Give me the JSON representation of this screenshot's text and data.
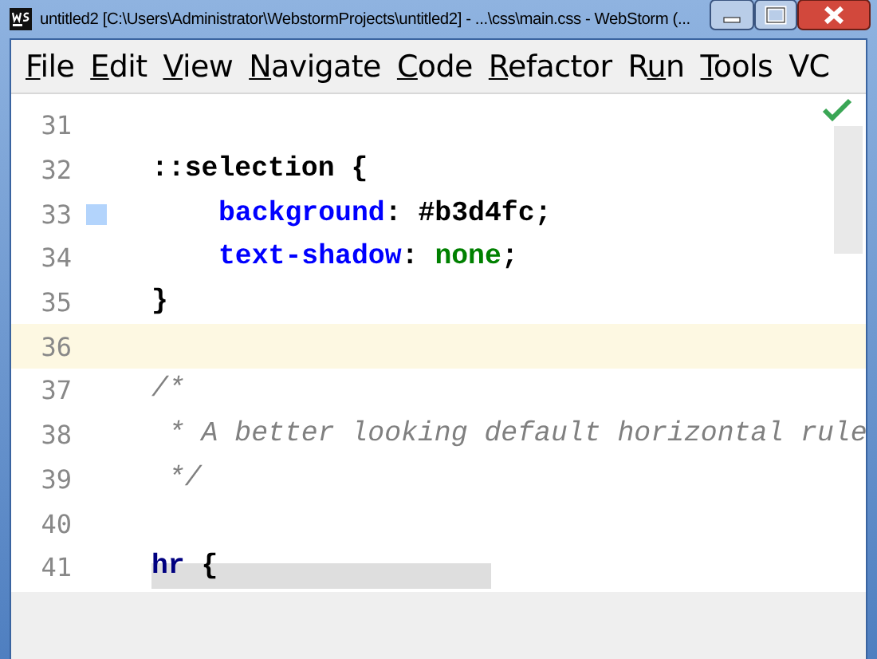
{
  "window": {
    "title": "untitled2 [C:\\Users\\Administrator\\WebstormProjects\\untitled2] - ...\\css\\main.css - WebStorm (..."
  },
  "menu": [
    {
      "parts": [
        {
          "text": "F",
          "underline": true
        },
        {
          "text": "ile",
          "underline": false
        }
      ]
    },
    {
      "parts": [
        {
          "text": "E",
          "underline": true
        },
        {
          "text": "dit",
          "underline": false
        }
      ]
    },
    {
      "parts": [
        {
          "text": "V",
          "underline": true
        },
        {
          "text": "iew",
          "underline": false
        }
      ]
    },
    {
      "parts": [
        {
          "text": "N",
          "underline": true
        },
        {
          "text": "avigate",
          "underline": false
        }
      ]
    },
    {
      "parts": [
        {
          "text": "C",
          "underline": true
        },
        {
          "text": "ode",
          "underline": false
        }
      ]
    },
    {
      "parts": [
        {
          "text": "R",
          "underline": true
        },
        {
          "text": "efactor",
          "underline": false
        }
      ]
    },
    {
      "parts": [
        {
          "text": "R",
          "underline": false
        },
        {
          "text": "u",
          "underline": true
        },
        {
          "text": "n",
          "underline": false
        }
      ]
    },
    {
      "parts": [
        {
          "text": "T",
          "underline": true
        },
        {
          "text": "ools",
          "underline": false
        }
      ]
    },
    {
      "parts": [
        {
          "text": "VC",
          "underline": false
        }
      ]
    }
  ],
  "editor": {
    "analysis_ok": true,
    "lines": [
      {
        "number": "31",
        "current": false
      },
      {
        "number": "32",
        "current": false,
        "tokens": [
          {
            "kind": "selector",
            "text": "::selection {"
          }
        ]
      },
      {
        "number": "33",
        "current": false,
        "indented": true,
        "color": "#b3d4fc",
        "tokens": [
          {
            "kind": "property",
            "text": "background"
          },
          {
            "kind": "punct",
            "text": ": "
          },
          {
            "kind": "value",
            "text": "#b3d4fc"
          },
          {
            "kind": "punct",
            "text": ";"
          }
        ]
      },
      {
        "number": "34",
        "current": false,
        "indented": true,
        "tokens": [
          {
            "kind": "property",
            "text": "text-shadow"
          },
          {
            "kind": "punct",
            "text": ": "
          },
          {
            "kind": "keyword",
            "text": "none"
          },
          {
            "kind": "punct",
            "text": ";"
          }
        ]
      },
      {
        "number": "35",
        "current": false,
        "tokens": [
          {
            "kind": "punct",
            "text": "}"
          }
        ]
      },
      {
        "number": "36",
        "current": true
      },
      {
        "number": "37",
        "current": false,
        "tokens": [
          {
            "kind": "comment",
            "text": "/*"
          }
        ]
      },
      {
        "number": "38",
        "current": false,
        "tokens": [
          {
            "kind": "comment",
            "text": " * A better looking default horizontal rule"
          }
        ]
      },
      {
        "number": "39",
        "current": false,
        "tokens": [
          {
            "kind": "comment",
            "text": " */"
          }
        ]
      },
      {
        "number": "40",
        "current": false
      },
      {
        "number": "41",
        "current": false,
        "tokens": [
          {
            "kind": "tag",
            "text": "hr"
          },
          {
            "kind": "punct",
            "text": " {"
          }
        ]
      }
    ]
  }
}
